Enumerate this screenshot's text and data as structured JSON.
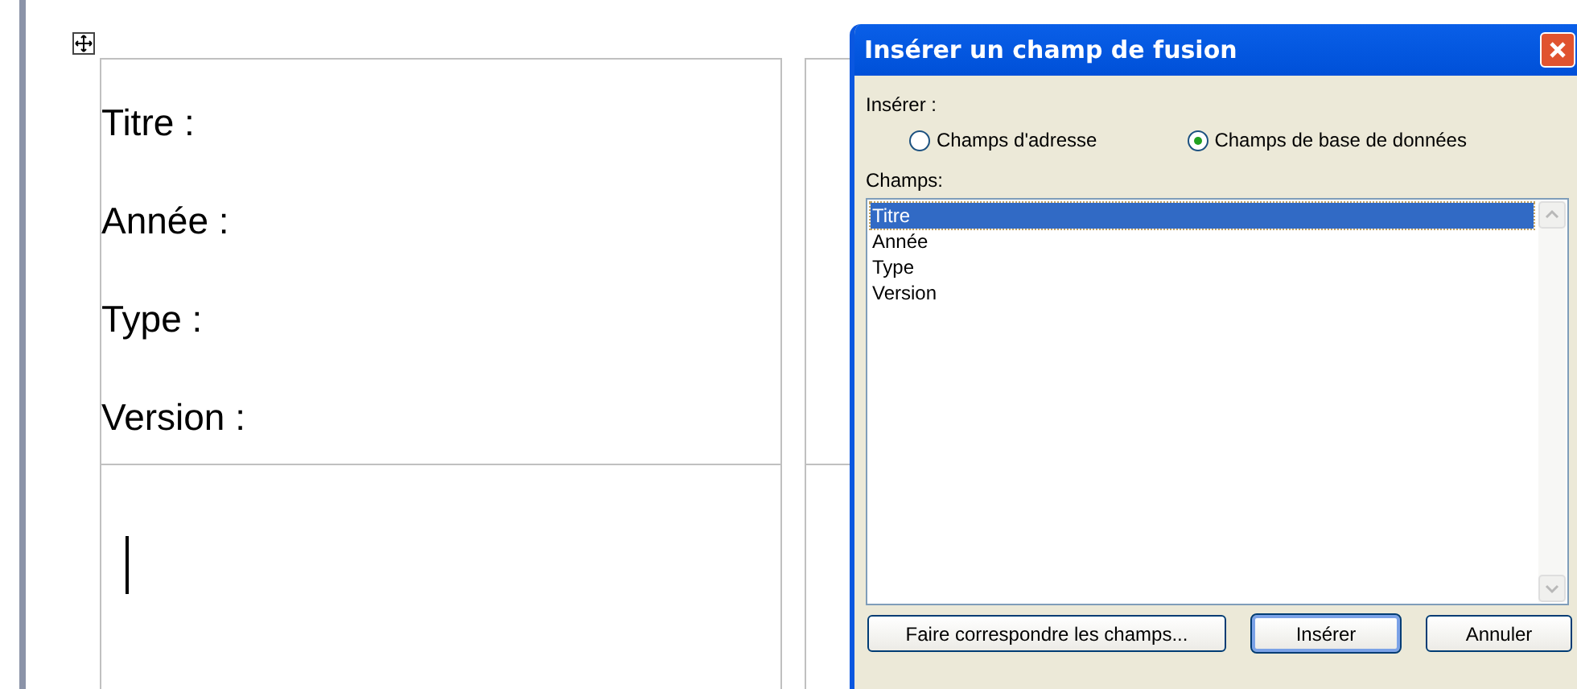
{
  "document": {
    "field_labels": [
      "Titre :",
      "Année :",
      "Type :",
      "Version :"
    ]
  },
  "dialog": {
    "title": "Insérer un champ de fusion",
    "insert_label": "Insérer :",
    "options": [
      {
        "label": "Champs d'adresse",
        "selected": false
      },
      {
        "label": "Champs de base de données",
        "selected": true
      }
    ],
    "fields_label": "Champs:",
    "fields": [
      {
        "label": "Titre",
        "selected": true
      },
      {
        "label": "Année",
        "selected": false
      },
      {
        "label": "Type",
        "selected": false
      },
      {
        "label": "Version",
        "selected": false
      }
    ],
    "buttons": [
      {
        "label": "Faire correspondre les champs...",
        "default": false
      },
      {
        "label": "Insérer",
        "default": true
      },
      {
        "label": "Annuler",
        "default": false
      }
    ]
  }
}
